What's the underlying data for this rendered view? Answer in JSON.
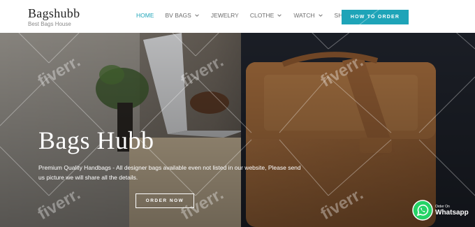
{
  "header": {
    "logo_title": "Bagshubb",
    "logo_tagline": "Best Bags House",
    "nav": [
      {
        "label": "HOME",
        "active": true
      },
      {
        "label": "BV BAGS",
        "dropdown": true
      },
      {
        "label": "JEWELRY"
      },
      {
        "label": "CLOTHE",
        "dropdown": true
      },
      {
        "label": "WATCH",
        "dropdown": true
      },
      {
        "label": "SHOES"
      }
    ],
    "cta_label": "HOW TO ORDER"
  },
  "hero": {
    "title": "Bags Hubb",
    "text": "Premium Quality Handbags - All designer bags available even not listed in our website, Please send us picture we will share all the details.",
    "button_label": "ORDER NOW"
  },
  "whatsapp": {
    "small_label": "Order On",
    "label": "Whatsapp"
  },
  "watermark": {
    "text": "fiverr.",
    "icon": "fiverr-watermark-icon"
  },
  "colors": {
    "accent": "#1ea4b8",
    "whatsapp_green": "#25d366"
  }
}
